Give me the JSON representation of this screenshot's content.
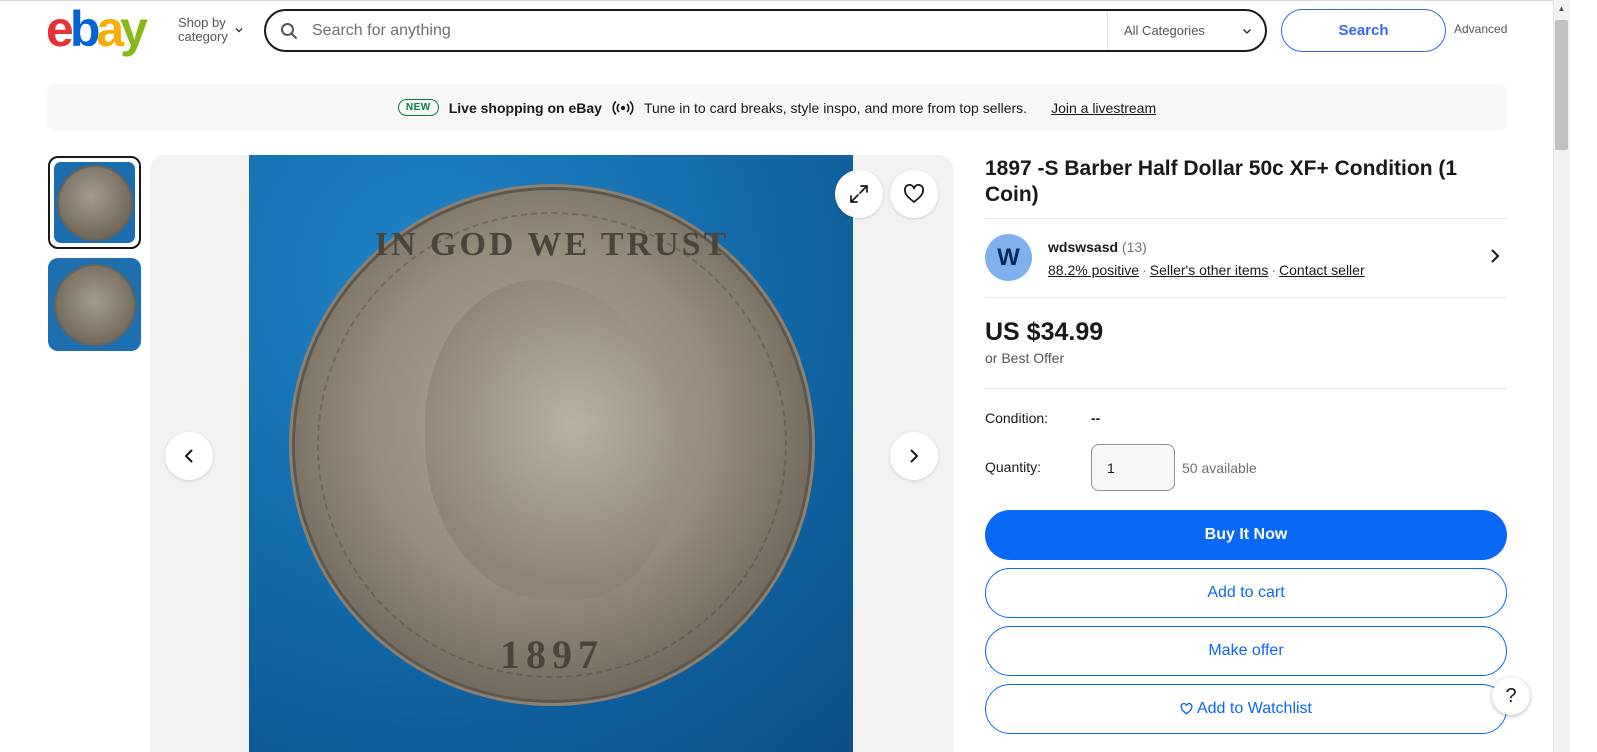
{
  "header": {
    "logo": {
      "e": "e",
      "b": "b",
      "a": "a",
      "y": "y"
    },
    "shop_by_line1": "Shop by",
    "shop_by_line2": "category",
    "search_placeholder": "Search for anything",
    "category_selected": "All Categories",
    "search_button": "Search",
    "advanced_link": "Advanced"
  },
  "banner": {
    "badge": "NEW",
    "title": "Live shopping on eBay",
    "text": "Tune in to card breaks, style inspo, and more from top sellers.",
    "link": "Join a livestream"
  },
  "gallery": {
    "coin_motto": "IN GOD WE TRUST",
    "coin_year": "1897",
    "thumbnails": [
      "obverse",
      "reverse"
    ]
  },
  "listing": {
    "title": "1897 -S Barber Half Dollar 50c XF+ Condition (1 Coin)",
    "seller": {
      "avatar_letter": "W",
      "name": "wdswsasd",
      "feedback_count": "(13)",
      "positive": "88.2% positive",
      "other_items": "Seller's other items",
      "contact": "Contact seller"
    },
    "price": "US $34.99",
    "best_offer": "or Best Offer",
    "condition_label": "Condition:",
    "condition_value": "--",
    "quantity_label": "Quantity:",
    "quantity_value": "1",
    "available": "50 available",
    "buttons": {
      "buy_now": "Buy It Now",
      "add_to_cart": "Add to cart",
      "make_offer": "Make offer",
      "watchlist": "Add to Watchlist"
    }
  },
  "help": "?",
  "colors": {
    "primary": "#0968f6",
    "search_blue": "#3665f3",
    "new_badge": "#05823f"
  }
}
